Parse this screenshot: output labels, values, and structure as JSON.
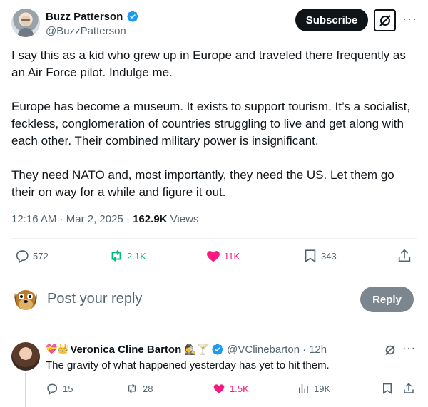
{
  "author": {
    "name": "Buzz Patterson",
    "handle": "@BuzzPatterson"
  },
  "header": {
    "subscribe_label": "Subscribe",
    "grok_icon": "grok-icon",
    "more_icon": "more-horizontal-icon"
  },
  "tweet": {
    "paragraphs": [
      "I say this as a kid who grew up in Europe and traveled there frequently as an Air Force pilot. Indulge me.",
      "Europe has become a museum. It exists to support tourism. It’s a socialist, feckless, conglomeration of countries struggling to live and get along with each other. Their combined military power is insignificant.",
      "They need NATO and, most importantly, they need the US. Let them go their on way for a while and figure it out."
    ],
    "time": "12:16 AM",
    "date": "Mar 2, 2025",
    "views_count": "162.9K",
    "views_label": "Views"
  },
  "actions": {
    "replies": "572",
    "reposts": "2.1K",
    "likes": "11K",
    "bookmarks": "343"
  },
  "reply_box": {
    "placeholder": "Post your reply",
    "button_label": "Reply"
  },
  "reply": {
    "prefix_emoji": "💝👑",
    "name": "Veronica Cline Barton",
    "suffix_emoji": "🕵️🍸",
    "handle": "@VClinebarton",
    "separator": "·",
    "time": "12h",
    "text": "The gravity of what happened yesterday has yet to hit them.",
    "replies": "15",
    "reposts": "28",
    "likes": "1.5K",
    "views": "19K"
  },
  "colors": {
    "verified": "#1d9bf0",
    "repost_active": "#00ba7c",
    "like_active": "#f91880",
    "secondary_text": "#536471"
  }
}
